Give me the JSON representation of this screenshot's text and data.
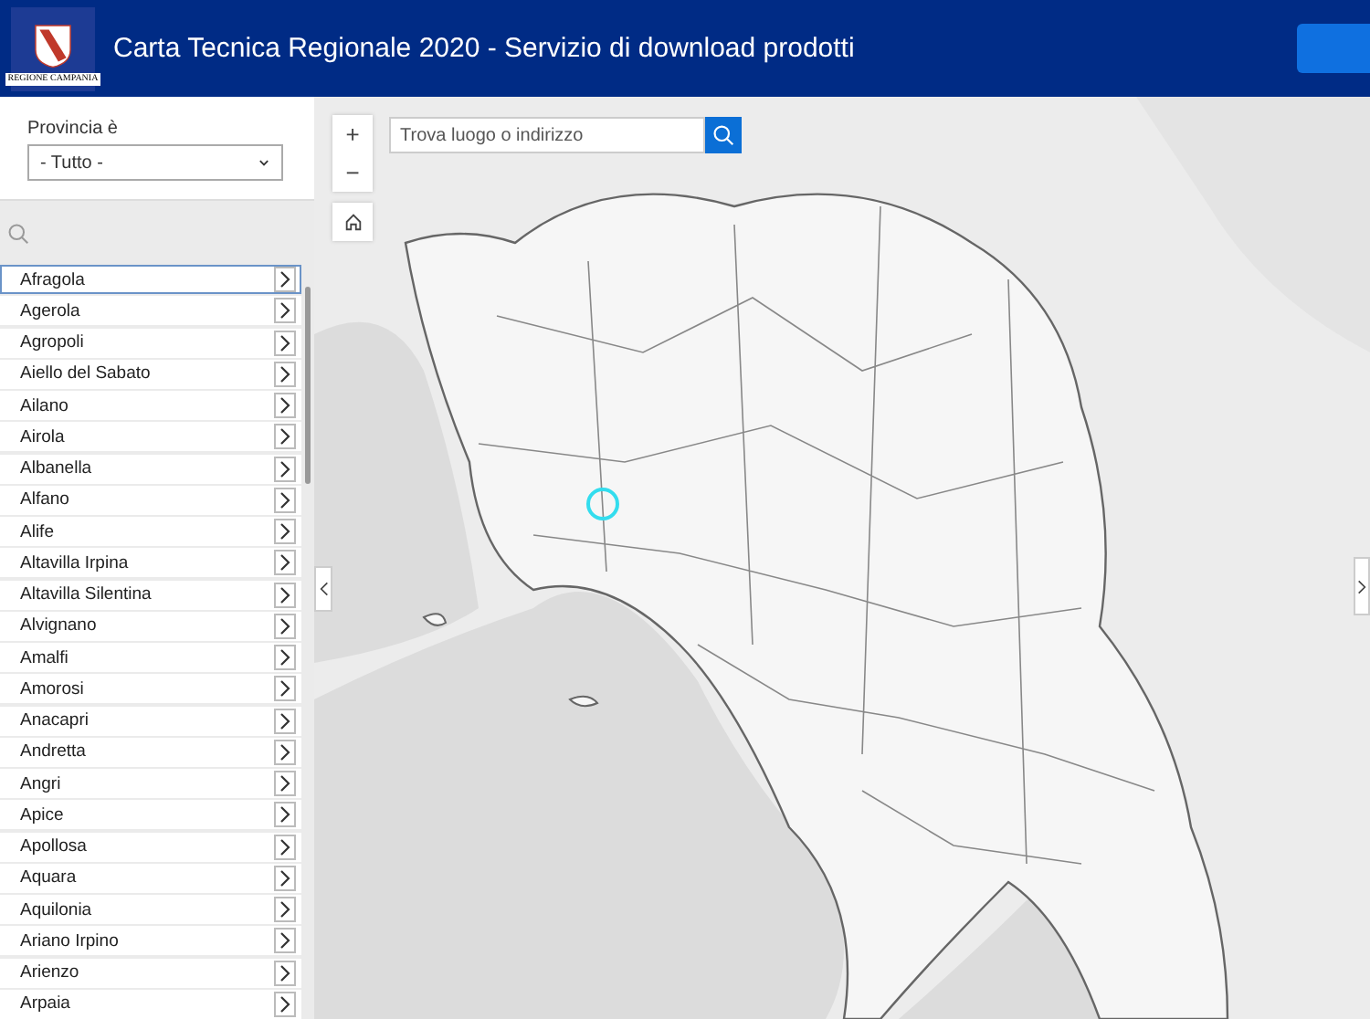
{
  "header": {
    "logo_caption": "REGIONE CAMPANIA",
    "title": "Carta Tecnica Regionale 2020 - Servizio di download prodotti"
  },
  "filter": {
    "label": "Provincia è",
    "value": "- Tutto -"
  },
  "list": {
    "items": [
      {
        "name": "Afragola",
        "selected": true
      },
      {
        "name": "Agerola",
        "selected": false
      },
      {
        "name": "Agropoli",
        "selected": false
      },
      {
        "name": "Aiello del Sabato",
        "selected": false
      },
      {
        "name": "Ailano",
        "selected": false
      },
      {
        "name": "Airola",
        "selected": false
      },
      {
        "name": "Albanella",
        "selected": false
      },
      {
        "name": "Alfano",
        "selected": false
      },
      {
        "name": "Alife",
        "selected": false
      },
      {
        "name": "Altavilla Irpina",
        "selected": false
      },
      {
        "name": "Altavilla Silentina",
        "selected": false
      },
      {
        "name": "Alvignano",
        "selected": false
      },
      {
        "name": "Amalfi",
        "selected": false
      },
      {
        "name": "Amorosi",
        "selected": false
      },
      {
        "name": "Anacapri",
        "selected": false
      },
      {
        "name": "Andretta",
        "selected": false
      },
      {
        "name": "Angri",
        "selected": false
      },
      {
        "name": "Apice",
        "selected": false
      },
      {
        "name": "Apollosa",
        "selected": false
      },
      {
        "name": "Aquara",
        "selected": false
      },
      {
        "name": "Aquilonia",
        "selected": false
      },
      {
        "name": "Ariano Irpino",
        "selected": false
      },
      {
        "name": "Arienzo",
        "selected": false
      },
      {
        "name": "Arpaia",
        "selected": false
      }
    ]
  },
  "map": {
    "kind": "picture",
    "zoom_in": "+",
    "zoom_out": "−",
    "search": {
      "placeholder": "Trova luogo o indirizzo"
    }
  }
}
